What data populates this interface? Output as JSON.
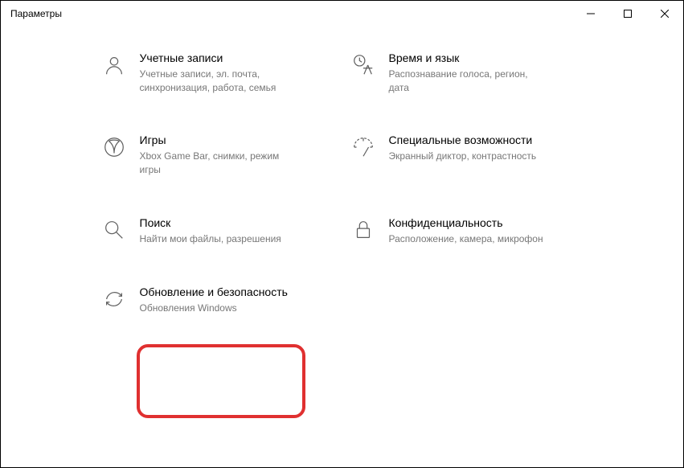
{
  "window": {
    "title": "Параметры"
  },
  "categories": {
    "accounts": {
      "title": "Учетные записи",
      "sub": "Учетные записи, эл. почта, синхронизация, работа, семья"
    },
    "timeLanguage": {
      "title": "Время и язык",
      "sub": "Распознавание голоса, регион, дата"
    },
    "gaming": {
      "title": "Игры",
      "sub": "Xbox Game Bar, снимки, режим игры"
    },
    "accessibility": {
      "title": "Специальные возможности",
      "sub": "Экранный диктор, контрастность"
    },
    "search": {
      "title": "Поиск",
      "sub": "Найти мои файлы, разрешения"
    },
    "privacy": {
      "title": "Конфиденциальность",
      "sub": "Расположение, камера, микрофон"
    },
    "update": {
      "title": "Обновление и безопасность",
      "sub": "Обновления Windows"
    }
  }
}
